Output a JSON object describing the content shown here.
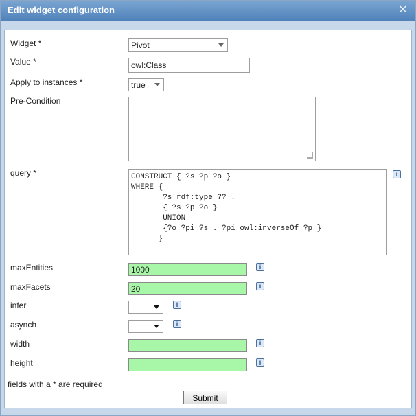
{
  "dialog": {
    "title": "Edit widget configuration",
    "close_icon": "close-icon"
  },
  "form": {
    "widget": {
      "label": "Widget *",
      "value": "Pivot"
    },
    "value": {
      "label": "Value *",
      "value": "owl:Class"
    },
    "apply_to_instances": {
      "label": "Apply to instances *",
      "value": "true"
    },
    "pre_condition": {
      "label": "Pre-Condition",
      "value": ""
    },
    "query": {
      "label": "query *",
      "value": "CONSTRUCT { ?s ?p ?o }\nWHERE {\n       ?s rdf:type ?? .\n       { ?s ?p ?o }\n       UNION\n       {?o ?pi ?s . ?pi owl:inverseOf ?p }\n      }"
    },
    "maxEntities": {
      "label": "maxEntities",
      "value": "1000"
    },
    "maxFacets": {
      "label": "maxFacets",
      "value": "20"
    },
    "infer": {
      "label": "infer",
      "value": ""
    },
    "asynch": {
      "label": "asynch",
      "value": ""
    },
    "width": {
      "label": "width",
      "value": ""
    },
    "height": {
      "label": "height",
      "value": ""
    },
    "required_note": "fields with a * are required",
    "submit_label": "Submit",
    "info_icon_glyph": "i"
  }
}
